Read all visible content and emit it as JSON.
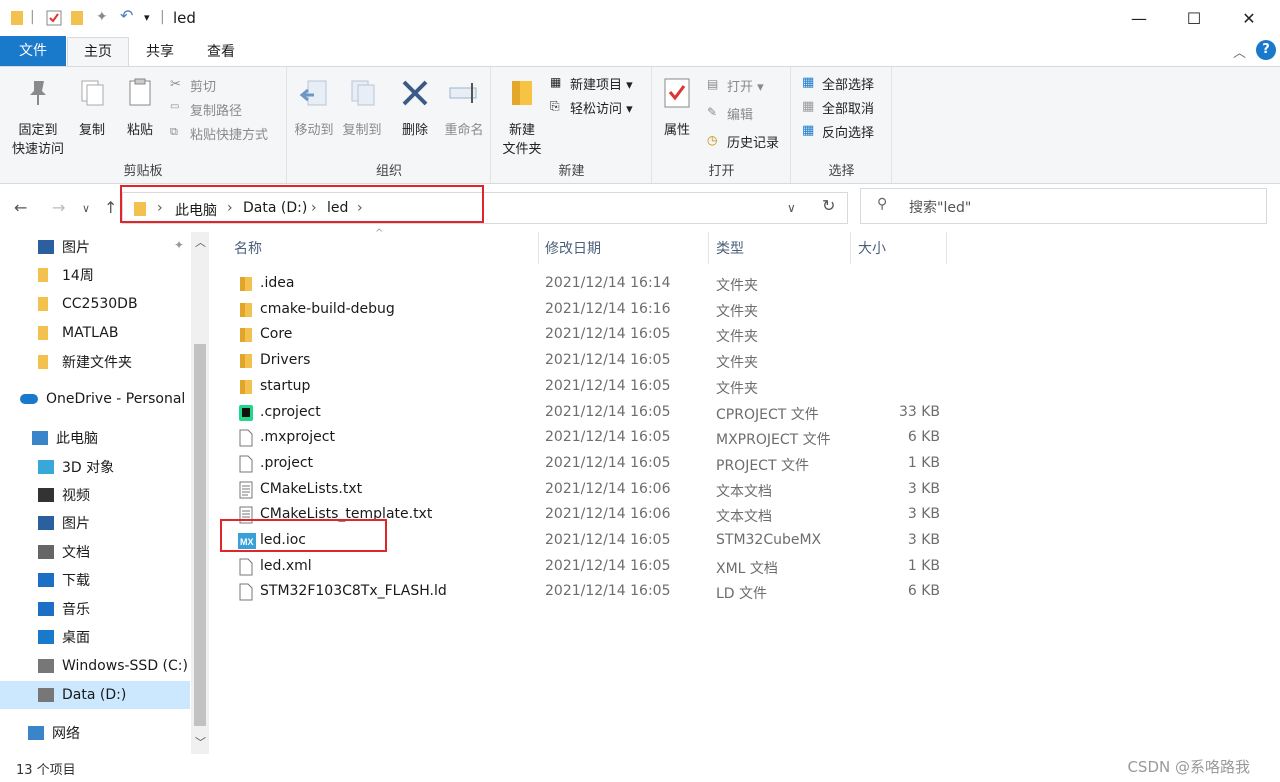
{
  "window": {
    "title": "led",
    "controls": {
      "minimize": "—",
      "maximize": "☐",
      "close": "✕"
    }
  },
  "ribbon_tabs": [
    "文件",
    "主页",
    "共享",
    "查看"
  ],
  "ribbon": {
    "clipboard": {
      "label": "剪贴板",
      "pin": "固定到\n快速访问",
      "pin_l1": "固定到",
      "pin_l2": "快速访问",
      "copy": "复制",
      "paste": "粘贴",
      "cut": "剪切",
      "copy_path": "复制路径",
      "paste_shortcut": "粘贴快捷方式"
    },
    "organize": {
      "label": "组织",
      "move_to": "移动到",
      "copy_to": "复制到",
      "delete": "删除",
      "rename": "重命名"
    },
    "new": {
      "label": "新建",
      "new_folder_l1": "新建",
      "new_folder_l2": "文件夹",
      "new_item": "新建项目 ▾",
      "easy_access": "轻松访问 ▾"
    },
    "open": {
      "label": "打开",
      "properties": "属性",
      "open": "打开 ▾",
      "edit": "编辑",
      "history": "历史记录"
    },
    "select": {
      "label": "选择",
      "select_all": "全部选择",
      "select_none": "全部取消",
      "invert": "反向选择"
    }
  },
  "address": {
    "crumbs": [
      "此电脑",
      "Data (D:)",
      "led"
    ],
    "search_placeholder": "搜索\"led\""
  },
  "nav_pane": [
    {
      "label": "图片",
      "icon": "pictures-icon",
      "pinned": true
    },
    {
      "label": "14周",
      "icon": "folder-icon"
    },
    {
      "label": "CC2530DB",
      "icon": "folder-icon"
    },
    {
      "label": "MATLAB",
      "icon": "folder-icon"
    },
    {
      "label": "新建文件夹",
      "icon": "folder-icon"
    },
    {
      "label": "OneDrive - Personal",
      "icon": "onedrive-icon"
    },
    {
      "label": "此电脑",
      "icon": "pc-icon"
    },
    {
      "label": "3D 对象",
      "icon": "3d-objects-icon"
    },
    {
      "label": "视频",
      "icon": "videos-icon"
    },
    {
      "label": "图片",
      "icon": "pictures-icon"
    },
    {
      "label": "文档",
      "icon": "documents-icon"
    },
    {
      "label": "下载",
      "icon": "downloads-icon"
    },
    {
      "label": "音乐",
      "icon": "music-icon"
    },
    {
      "label": "桌面",
      "icon": "desktop-icon"
    },
    {
      "label": "Windows-SSD (C:)",
      "icon": "drive-c-icon"
    },
    {
      "label": "Data (D:)",
      "icon": "drive-d-icon",
      "selected": true
    },
    {
      "label": "网络",
      "icon": "network-icon"
    }
  ],
  "columns": {
    "name": "名称",
    "date": "修改日期",
    "type": "类型",
    "size": "大小"
  },
  "files": [
    {
      "name": ".idea",
      "date": "2021/12/14 16:14",
      "type": "文件夹",
      "size": "",
      "icon": "folder"
    },
    {
      "name": "cmake-build-debug",
      "date": "2021/12/14 16:16",
      "type": "文件夹",
      "size": "",
      "icon": "folder"
    },
    {
      "name": "Core",
      "date": "2021/12/14 16:05",
      "type": "文件夹",
      "size": "",
      "icon": "folder"
    },
    {
      "name": "Drivers",
      "date": "2021/12/14 16:05",
      "type": "文件夹",
      "size": "",
      "icon": "folder"
    },
    {
      "name": "startup",
      "date": "2021/12/14 16:05",
      "type": "文件夹",
      "size": "",
      "icon": "folder"
    },
    {
      "name": ".cproject",
      "date": "2021/12/14 16:05",
      "type": "CPROJECT 文件",
      "size": "33 KB",
      "icon": "clion"
    },
    {
      "name": ".mxproject",
      "date": "2021/12/14 16:05",
      "type": "MXPROJECT 文件",
      "size": "6 KB",
      "icon": "file"
    },
    {
      "name": ".project",
      "date": "2021/12/14 16:05",
      "type": "PROJECT 文件",
      "size": "1 KB",
      "icon": "file"
    },
    {
      "name": "CMakeLists.txt",
      "date": "2021/12/14 16:06",
      "type": "文本文档",
      "size": "3 KB",
      "icon": "text"
    },
    {
      "name": "CMakeLists_template.txt",
      "date": "2021/12/14 16:06",
      "type": "文本文档",
      "size": "3 KB",
      "icon": "text"
    },
    {
      "name": "led.ioc",
      "date": "2021/12/14 16:05",
      "type": "STM32CubeMX",
      "size": "3 KB",
      "icon": "mx"
    },
    {
      "name": "led.xml",
      "date": "2021/12/14 16:05",
      "type": "XML 文档",
      "size": "1 KB",
      "icon": "file"
    },
    {
      "name": "STM32F103C8Tx_FLASH.ld",
      "date": "2021/12/14 16:05",
      "type": "LD 文件",
      "size": "6 KB",
      "icon": "file"
    }
  ],
  "status": {
    "item_count": "13 个项目"
  },
  "watermark": "CSDN @系咯路我"
}
